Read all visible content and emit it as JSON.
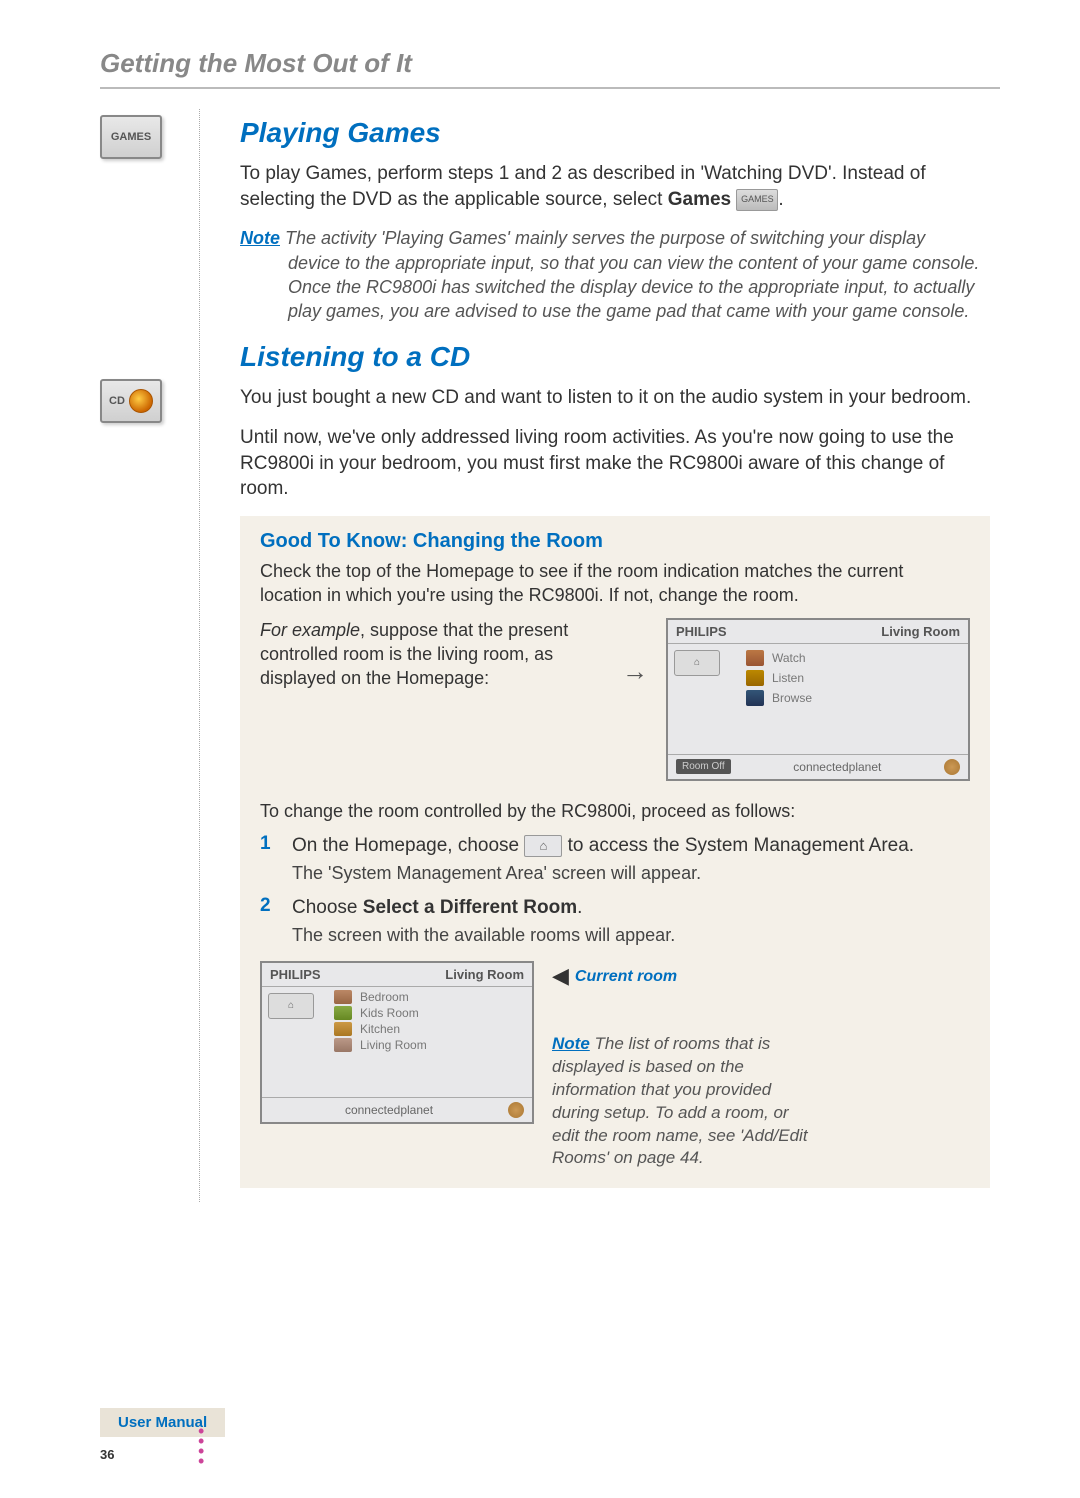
{
  "chapter": "Getting the Most Out of It",
  "section1": {
    "title": "Playing Games",
    "intro_pre": "To play Games, perform steps 1 and 2 as described in 'Watching DVD'. Instead of selecting the DVD as the applicable source, select ",
    "intro_bold": "Games",
    "intro_post": ".",
    "note_label": "Note",
    "note_first": " The activity 'Playing Games' mainly serves the purpose of switching your display",
    "note_rest": "device to the appropriate input, so that you can view the content of your game console. Once the RC9800i has switched the display device to the appropriate input, to actually play games, you are advised to use the game pad that came with your game console."
  },
  "section2": {
    "title": "Listening to a CD",
    "p1": "You just bought a new CD and want to listen to it on the audio system in your bedroom.",
    "p2": "Until now, we've only addressed living room activities. As you're now going to use the RC9800i in your bedroom, you must first make the RC9800i aware of this change of room."
  },
  "gtk": {
    "title": "Good To Know: Changing the Room",
    "body": "Check the top of the Homepage to see if the room indication matches the current location in which you're using the RC9800i. If not, change the room.",
    "example_lead": "For example",
    "example_rest": ", suppose that the present controlled room is the living room, as displayed on the Homepage:",
    "change_intro": "To change the room controlled by the RC9800i, proceed as follows:",
    "step1_num": "1",
    "step1_pre": "On the Homepage, choose ",
    "step1_post": " to access the System Management Area.",
    "step1_result": "The 'System Management Area' screen will appear.",
    "step2_num": "2",
    "step2_pre": "Choose ",
    "step2_bold": "Select a Different Room",
    "step2_post": ".",
    "step2_result": "The screen with the available rooms will appear.",
    "current_room_callout": "Current room",
    "side_note_label": "Note",
    "side_note": " The list of rooms that is displayed is based on the information that you provided during setup. To add a room, or edit the room name, see 'Add/Edit Rooms' on page 44."
  },
  "device1": {
    "brand": "PHILIPS",
    "room": "Living Room",
    "actions": {
      "watch": "Watch",
      "listen": "Listen",
      "browse": "Browse"
    },
    "off": "Room Off",
    "footer": "connectedplanet"
  },
  "device2": {
    "brand": "PHILIPS",
    "room": "Living Room",
    "rooms": {
      "bedroom": "Bedroom",
      "kids": "Kids Room",
      "kitchen": "Kitchen",
      "living": "Living Room"
    },
    "footer": "connectedplanet"
  },
  "margin": {
    "games_label": "GAMES",
    "cd_label": "CD"
  },
  "footer": {
    "label": "User Manual",
    "page": "36"
  },
  "icons": {
    "games_inline": "GAMES"
  }
}
